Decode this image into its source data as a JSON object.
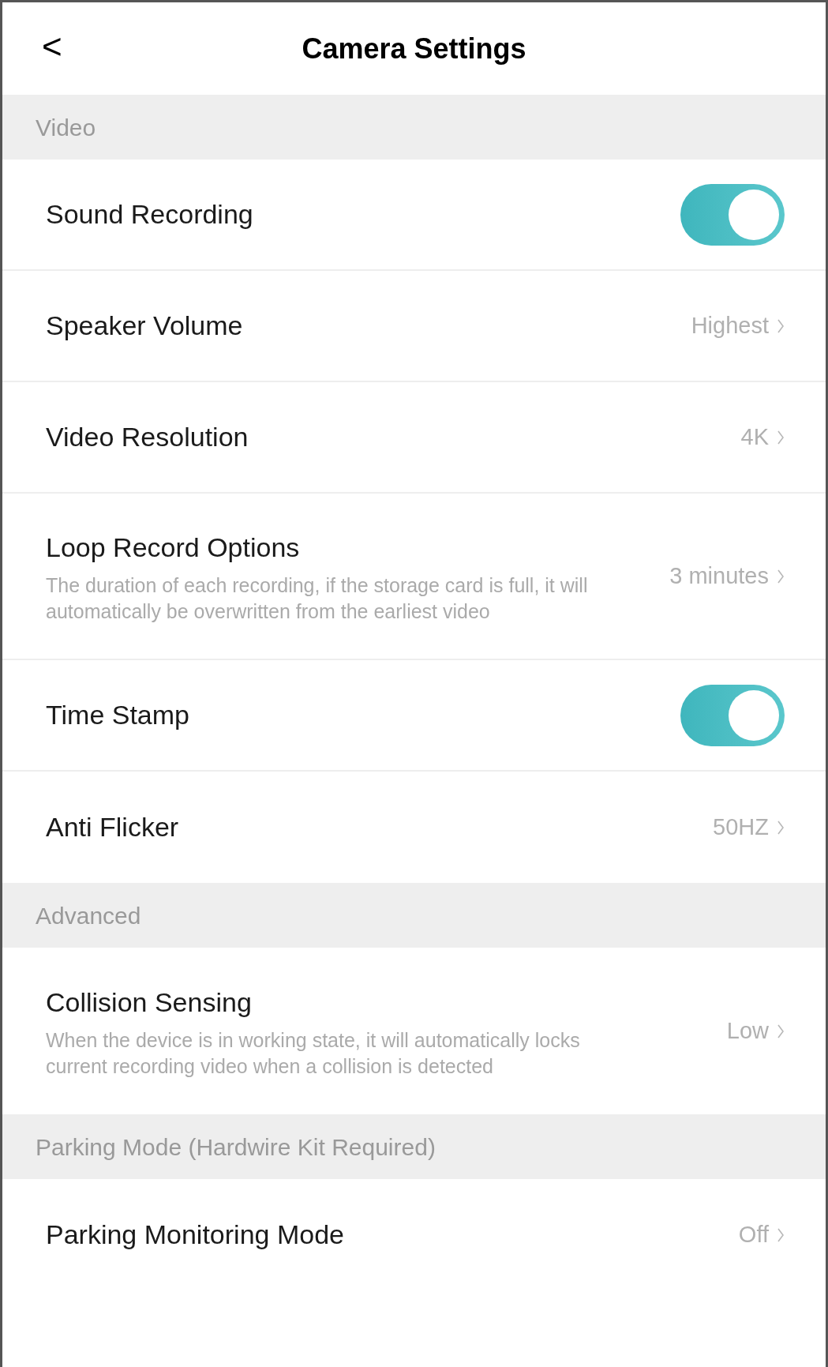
{
  "header": {
    "back": "<",
    "title": "Camera Settings"
  },
  "sections": [
    {
      "title": "Video",
      "rows": [
        {
          "kind": "toggle",
          "label": "Sound Recording",
          "on": true
        },
        {
          "kind": "value",
          "label": "Speaker Volume",
          "value": "Highest"
        },
        {
          "kind": "value",
          "label": "Video Resolution",
          "value": "4K"
        },
        {
          "kind": "value",
          "label": "Loop Record Options",
          "description": "The duration of each recording, if the storage card is full, it will automatically be overwritten from the earliest video",
          "value": "3 minutes"
        },
        {
          "kind": "toggle",
          "label": "Time Stamp",
          "on": true
        },
        {
          "kind": "value",
          "label": "Anti Flicker",
          "value": "50HZ"
        }
      ]
    },
    {
      "title": "Advanced",
      "rows": [
        {
          "kind": "value",
          "label": "Collision Sensing",
          "description": "When the device is in working state, it will automatically locks current recording video when a collision is detected",
          "value": "Low"
        }
      ]
    },
    {
      "title": "Parking Mode (Hardwire Kit Required)",
      "rows": [
        {
          "kind": "value",
          "label": "Parking Monitoring Mode",
          "value": "Off"
        }
      ]
    }
  ]
}
